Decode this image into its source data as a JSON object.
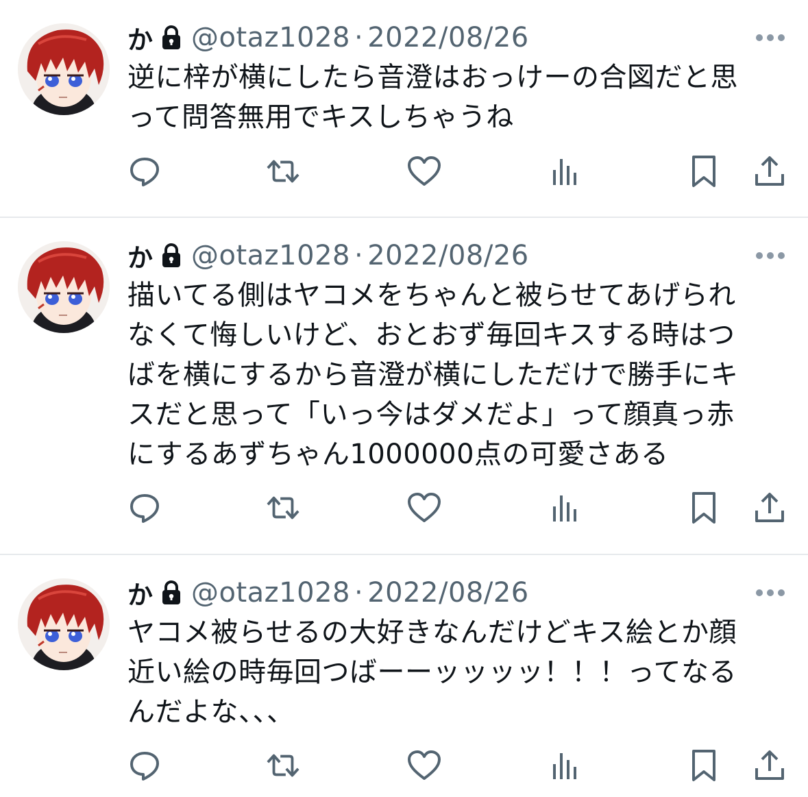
{
  "tweets": [
    {
      "name": "か",
      "handle": "@otaz1028",
      "separator": "·",
      "date": "2022/08/26",
      "text": "逆に梓が横にしたら音澄はおっけーの合図だと思\nって問答無用でキスしちゃうね"
    },
    {
      "name": "か",
      "handle": "@otaz1028",
      "separator": "·",
      "date": "2022/08/26",
      "text": "描いてる側はヤコメをちゃんと被らせてあげられ\nなくて悔しいけど、おとおず毎回キスする時はつ\nばを横にするから音澄が横にしただけで勝手にキ\nスだと思って「いっ今はダメだよ」って顔真っ赤\nにするあずちゃん1000000点の可愛さある"
    },
    {
      "name": "か",
      "handle": "@otaz1028",
      "separator": "·",
      "date": "2022/08/26",
      "text": "ヤコメ被らせるの大好きなんだけどキス絵とか顔\n近い絵の時毎回つばーーッッッッ！！！ってなる\nんだよな、、、"
    }
  ],
  "icons": {
    "lock": "lock-icon",
    "more": "more-dots-icon",
    "reply": "reply-icon",
    "retweet": "retweet-icon",
    "like": "heart-icon",
    "views": "views-chart-icon",
    "bookmark": "bookmark-icon",
    "share": "share-icon"
  },
  "colors": {
    "text": "#0f1419",
    "secondary": "#536471",
    "divider": "#e6e9ec",
    "avatar_hair": "#b3231f",
    "avatar_eyes": "#3d5fd8"
  }
}
